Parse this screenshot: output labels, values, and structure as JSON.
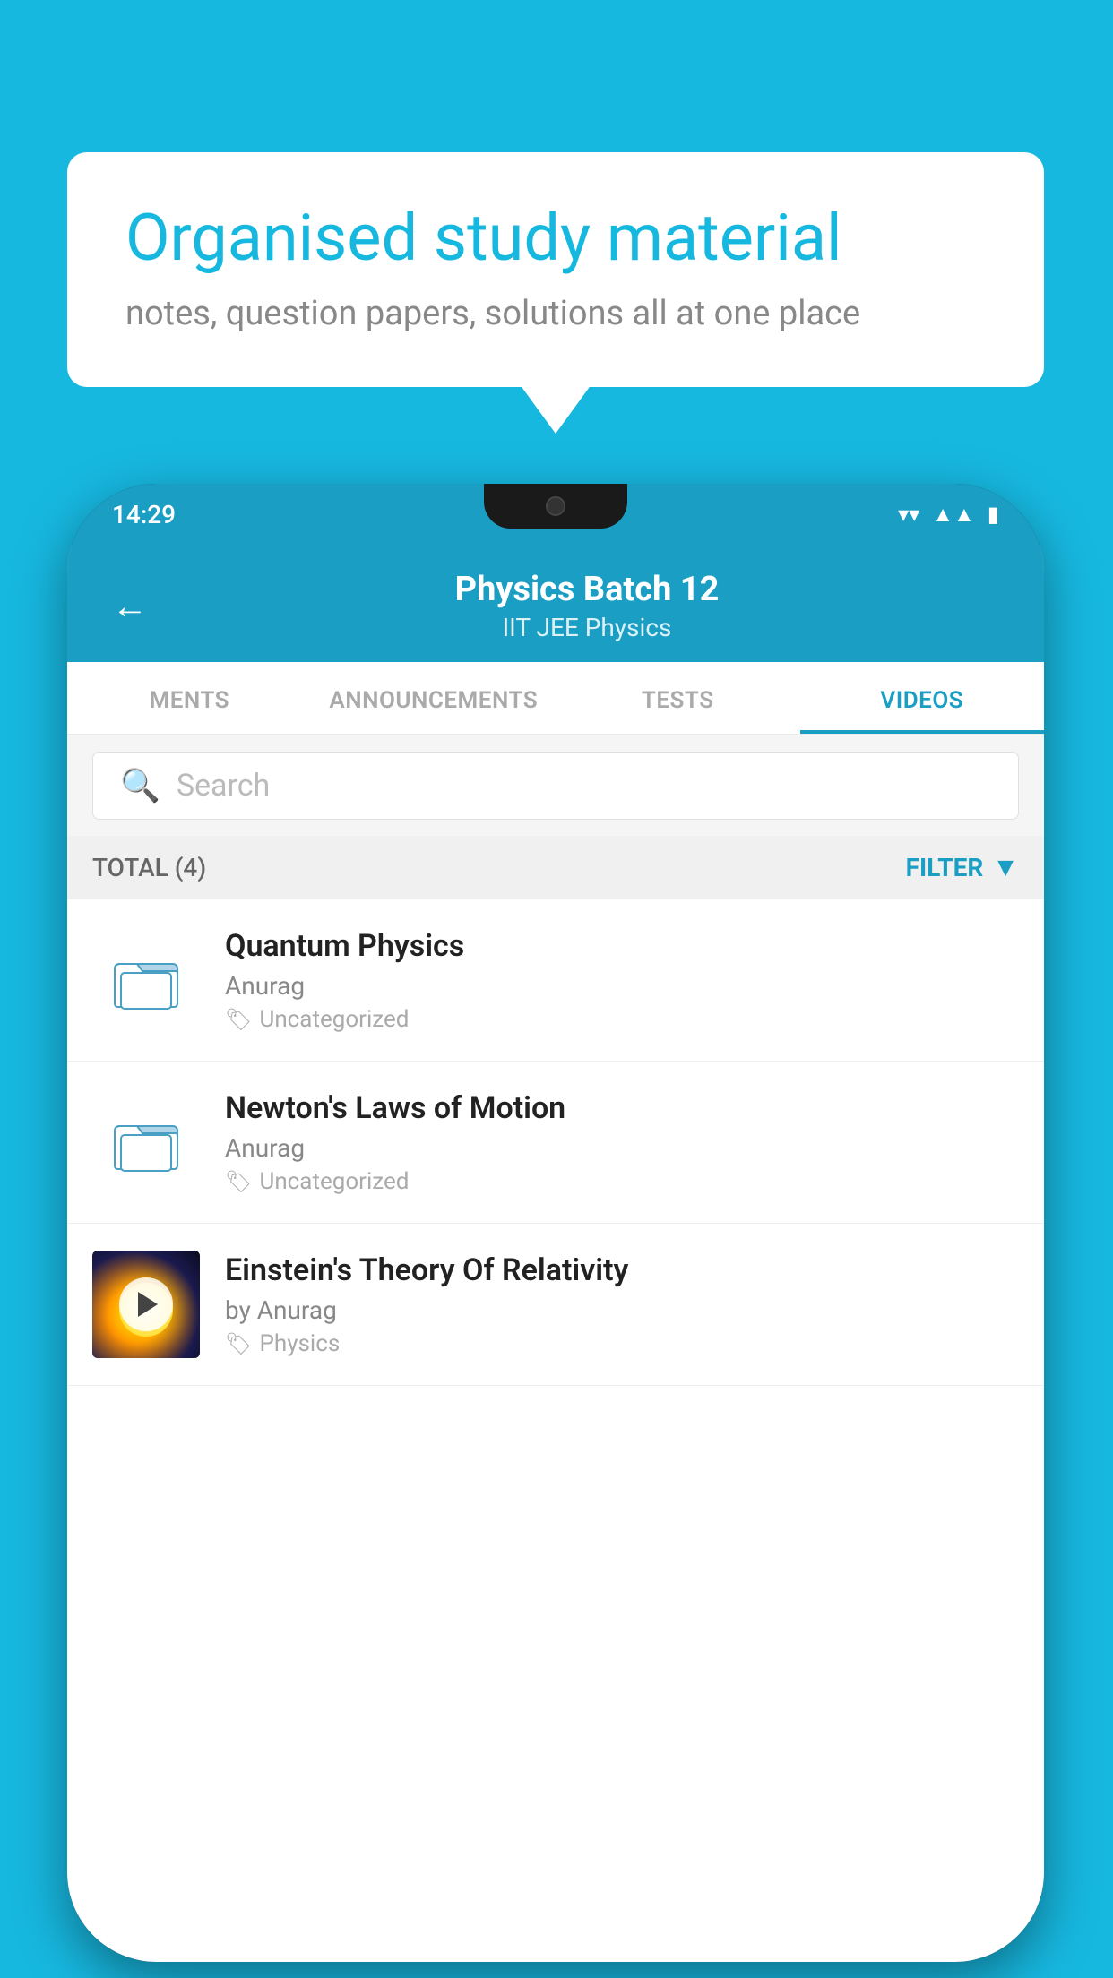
{
  "background_color": "#17b8e0",
  "bubble": {
    "title": "Organised study material",
    "subtitle": "notes, question papers, solutions all at one place"
  },
  "status_bar": {
    "time": "14:29",
    "icons": [
      "wifi",
      "signal",
      "battery"
    ]
  },
  "header": {
    "title": "Physics Batch 12",
    "subtitle_tags": "IIT JEE   Physics",
    "back_label": "←"
  },
  "tabs": [
    {
      "label": "MENTS",
      "active": false
    },
    {
      "label": "ANNOUNCEMENTS",
      "active": false
    },
    {
      "label": "TESTS",
      "active": false
    },
    {
      "label": "VIDEOS",
      "active": true
    }
  ],
  "search": {
    "placeholder": "Search"
  },
  "filter_bar": {
    "total_label": "TOTAL (4)",
    "filter_label": "FILTER"
  },
  "videos": [
    {
      "id": 1,
      "title": "Quantum Physics",
      "author": "Anurag",
      "tag": "Uncategorized",
      "type": "folder",
      "has_thumbnail": false
    },
    {
      "id": 2,
      "title": "Newton's Laws of Motion",
      "author": "Anurag",
      "tag": "Uncategorized",
      "type": "folder",
      "has_thumbnail": false
    },
    {
      "id": 3,
      "title": "Einstein's Theory Of Relativity",
      "author": "by Anurag",
      "tag": "Physics",
      "type": "video",
      "has_thumbnail": true
    }
  ]
}
